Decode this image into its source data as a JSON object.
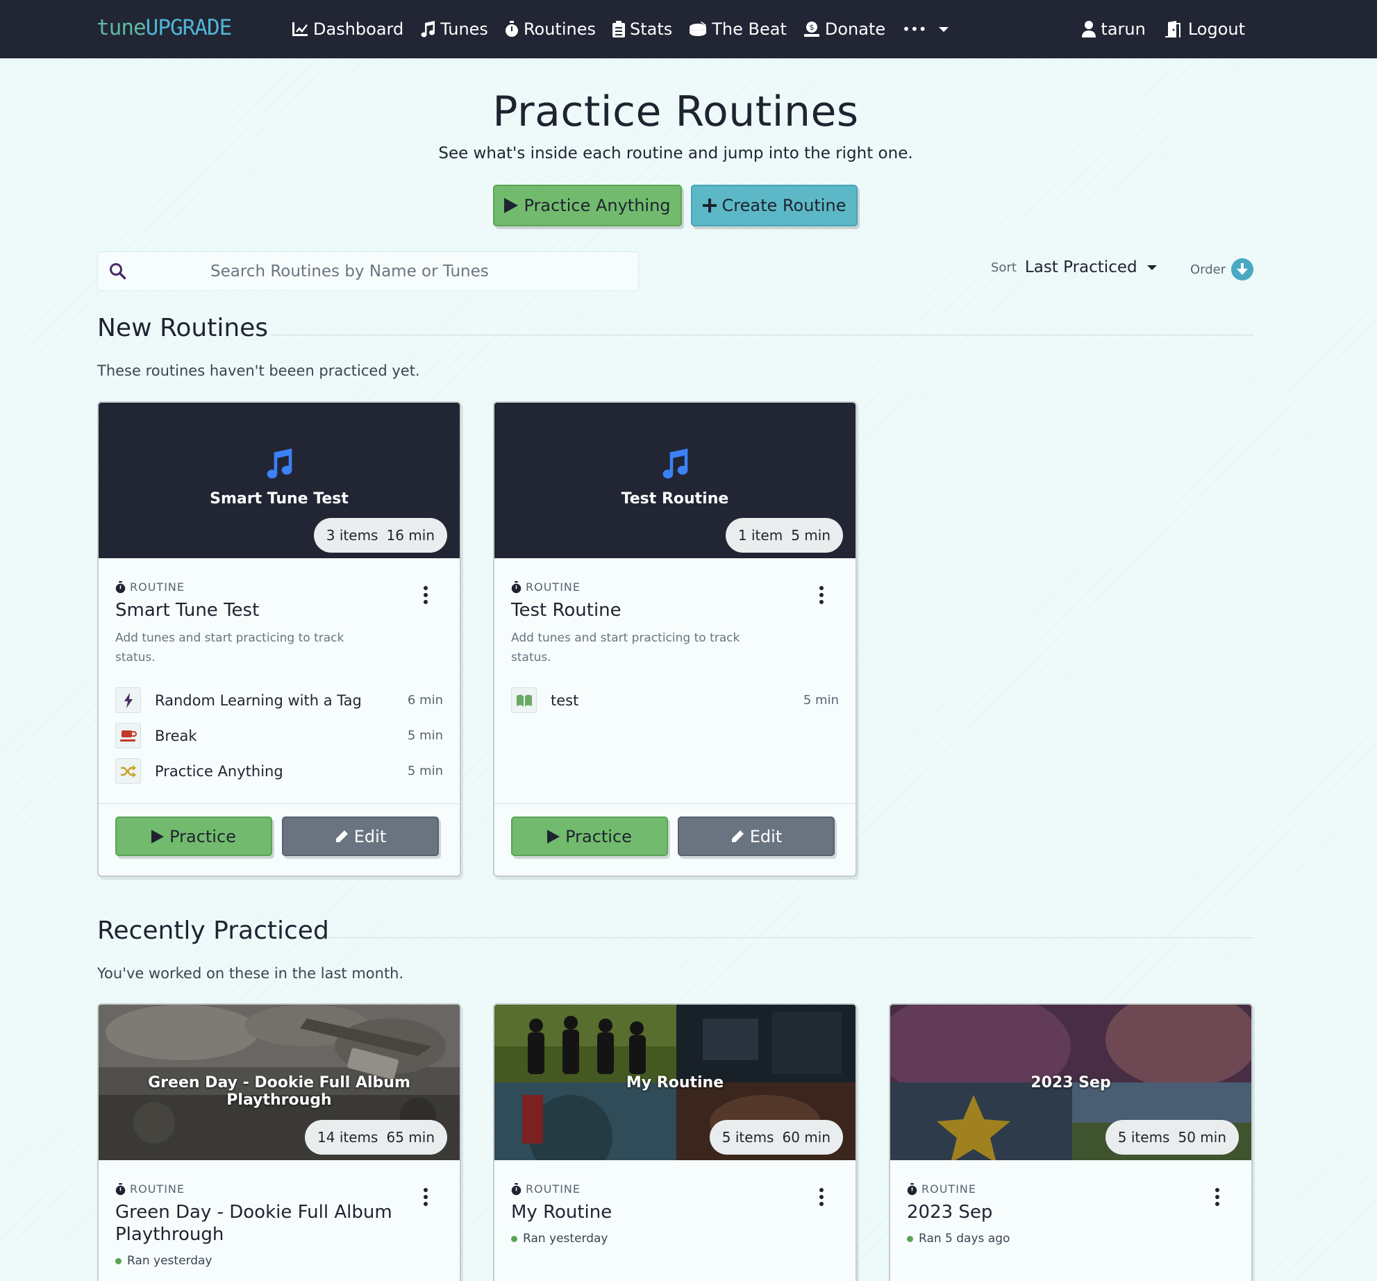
{
  "nav": {
    "brand_a": "tune",
    "brand_b": "UPGRADE",
    "links": [
      {
        "label": "Dashboard",
        "icon": "chart-line-icon"
      },
      {
        "label": "Tunes",
        "icon": "music-note-icon"
      },
      {
        "label": "Routines",
        "icon": "stopwatch-icon"
      },
      {
        "label": "Stats",
        "icon": "clipboard-icon"
      },
      {
        "label": "The Beat",
        "icon": "drum-icon"
      },
      {
        "label": "Donate",
        "icon": "donate-icon"
      }
    ],
    "more_label": "•••",
    "user": "tarun",
    "logout": "Logout"
  },
  "header": {
    "title": "Practice Routines",
    "subtitle": "See what's inside each routine and jump into the right one.",
    "practice_anything": "Practice Anything",
    "create_routine": "Create Routine"
  },
  "search": {
    "placeholder": "Search Routines by Name or Tunes",
    "value": ""
  },
  "sort": {
    "label": "Sort",
    "value": "Last Practiced",
    "order_label": "Order",
    "order_direction": "descending"
  },
  "sections": {
    "new": {
      "title": "New Routines",
      "desc": "These routines haven't beeen practiced yet."
    },
    "recent": {
      "title": "Recently Practiced",
      "desc": "You've worked on these in the last month."
    }
  },
  "eyebrow": "ROUTINE",
  "practice_label": "Practice",
  "edit_label": "Edit",
  "new_routines": [
    {
      "banner_title": "Smart Tune Test",
      "items_count": "3 items",
      "duration": "16 min",
      "title": "Smart Tune Test",
      "hint": "Add tunes and start practicing to track status.",
      "items": [
        {
          "name": "Random Learning with a Tag",
          "duration": "6 min",
          "icon": "bolt-icon"
        },
        {
          "name": "Break",
          "duration": "5 min",
          "icon": "coffee-icon"
        },
        {
          "name": "Practice Anything",
          "duration": "5 min",
          "icon": "shuffle-icon"
        }
      ]
    },
    {
      "banner_title": "Test Routine",
      "items_count": "1 item",
      "duration": "5 min",
      "title": "Test Routine",
      "hint": "Add tunes and start practicing to track status.",
      "items": [
        {
          "name": "test",
          "duration": "5 min",
          "icon": "book-icon"
        }
      ]
    }
  ],
  "recent_routines": [
    {
      "banner_title": "Green Day - Dookie Full Album Playthrough",
      "items_count": "14 items",
      "duration": "65 min",
      "title": "Green Day - Dookie Full Album Playthrough",
      "ran": "Ran yesterday"
    },
    {
      "banner_title": "My Routine",
      "items_count": "5 items",
      "duration": "60 min",
      "title": "My Routine",
      "ran": "Ran yesterday"
    },
    {
      "banner_title": "2023 Sep",
      "items_count": "5 items",
      "duration": "50 min",
      "title": "2023 Sep",
      "ran": "Ran 5 days ago"
    }
  ],
  "colors": {
    "navbar": "#212534",
    "practice_green": "#72bb6e",
    "create_teal": "#5cb8c6",
    "edit_grey": "#6a7480",
    "note_blue": "#3b82f6",
    "status_green": "#5aa356"
  }
}
